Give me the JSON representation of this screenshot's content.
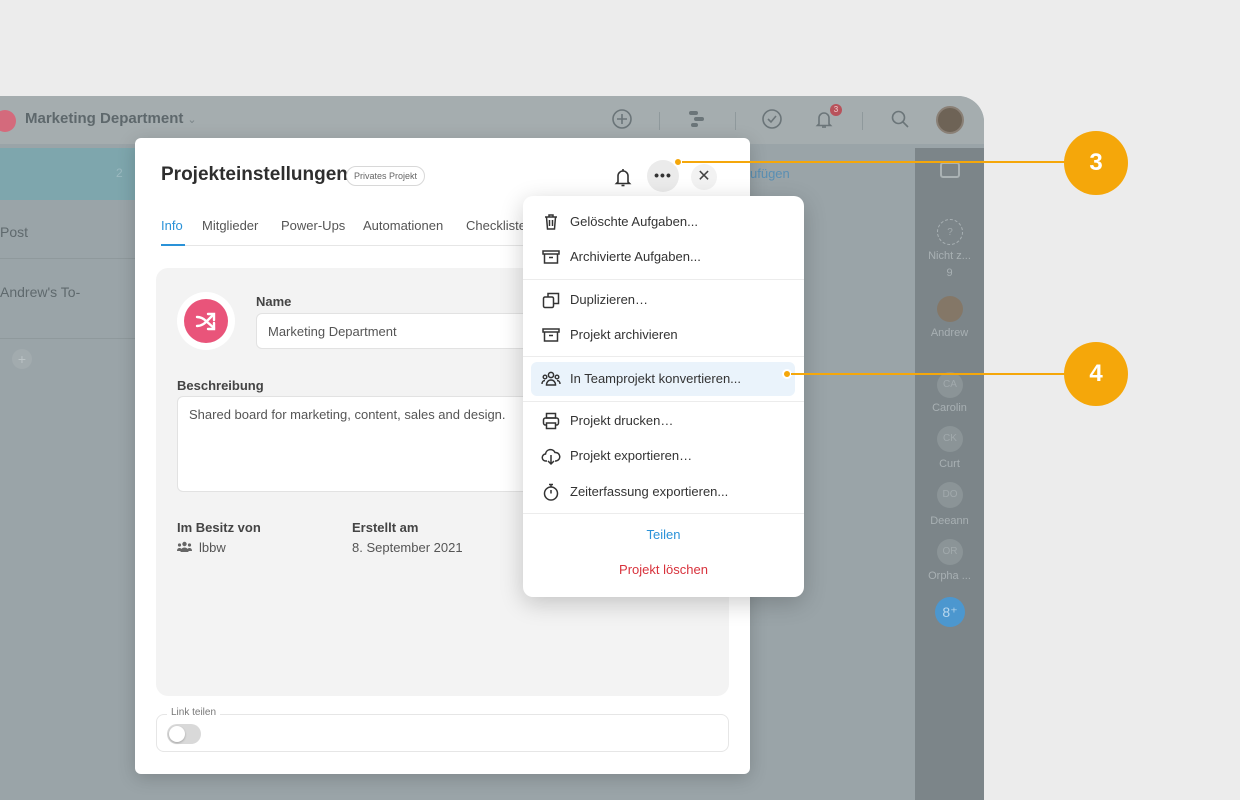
{
  "background_app": {
    "workspace_title": "Marketing Department",
    "notification_count": "3",
    "column_count": "2",
    "left_cards": [
      "Post",
      "Andrew's To-"
    ],
    "add_tasks_link": "ufügen",
    "right_members": [
      {
        "initials": "?",
        "label": "Nicht z...",
        "count": "9"
      },
      {
        "initials": "",
        "label": "Andrew"
      },
      {
        "initials": "CA",
        "label": "Carolin"
      },
      {
        "initials": "CK",
        "label": "Curt"
      },
      {
        "initials": "DO",
        "label": "Deeann"
      },
      {
        "initials": "OR",
        "label": "Orpha ..."
      }
    ]
  },
  "dialog": {
    "title": "Projekteinstellungen",
    "badge": "Privates Projekt",
    "more_label": "•••",
    "close_label": "✕",
    "tabs": [
      "Info",
      "Mitglieder",
      "Power-Ups",
      "Automationen",
      "Checkliste"
    ],
    "active_tab": "Info",
    "name_label": "Name",
    "name_value": "Marketing Department",
    "description_label": "Beschreibung",
    "description_value": "Shared board for marketing, content, sales and design.",
    "owner_label": "Im Besitz von",
    "owner_value": "lbbw",
    "created_label": "Erstellt am",
    "created_value": "8. September 2021",
    "link_share_label": "Link teilen",
    "link_share_enabled": false
  },
  "menu": {
    "items": [
      {
        "label": "Gelöschte Aufgaben...",
        "icon": "trash-icon"
      },
      {
        "label": "Archivierte Aufgaben...",
        "icon": "archive-box-icon"
      },
      {
        "label": "Duplizieren…",
        "icon": "duplicate-icon"
      },
      {
        "label": "Projekt archivieren",
        "icon": "archive-box-icon"
      },
      {
        "label": "In Teamprojekt konvertieren...",
        "icon": "team-icon",
        "highlighted": true
      },
      {
        "label": "Projekt drucken…",
        "icon": "printer-icon"
      },
      {
        "label": "Projekt exportieren…",
        "icon": "cloud-download-icon"
      },
      {
        "label": "Zeiterfassung exportieren...",
        "icon": "stopwatch-icon"
      }
    ],
    "share_label": "Teilen",
    "delete_label": "Projekt löschen",
    "share_color": "#2a92d8",
    "delete_color": "#d8323c"
  },
  "callouts": [
    {
      "number": "3",
      "target": "more-button"
    },
    {
      "number": "4",
      "target": "convert-to-team-project"
    }
  ],
  "colors": {
    "accent": "#2a92d8",
    "callout": "#f5a70a",
    "project_icon": "#e9547a"
  }
}
